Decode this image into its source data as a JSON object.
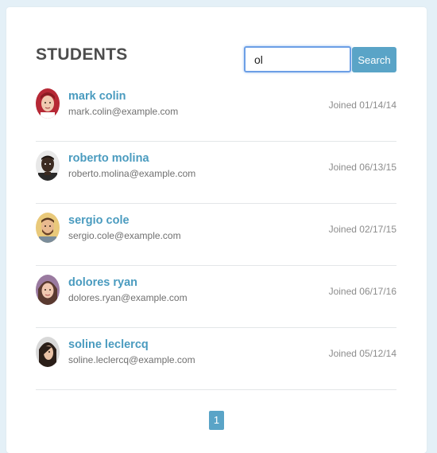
{
  "page": {
    "title": "STUDENTS"
  },
  "search": {
    "value": "ol",
    "button_label": "Search"
  },
  "students": [
    {
      "name": "mark colin",
      "email": "mark.colin@example.com",
      "joined": "Joined 01/14/14",
      "avatar": "avatar-photo-woman-red-hair"
    },
    {
      "name": "roberto molina",
      "email": "roberto.molina@example.com",
      "joined": "Joined 06/13/15",
      "avatar": "avatar-photo-man-dark-skin"
    },
    {
      "name": "sergio cole",
      "email": "sergio.cole@example.com",
      "joined": "Joined 02/17/15",
      "avatar": "avatar-photo-man-beard"
    },
    {
      "name": "dolores ryan",
      "email": "dolores.ryan@example.com",
      "joined": "Joined 06/17/16",
      "avatar": "avatar-photo-woman-curly-hair"
    },
    {
      "name": "soline leclercq",
      "email": "soline.leclercq@example.com",
      "joined": "Joined 05/12/14",
      "avatar": "avatar-photo-woman-long-hair"
    }
  ],
  "pagination": {
    "pages": [
      "1"
    ],
    "current": "1"
  },
  "colors": {
    "accent": "#5aa4c7",
    "name_link": "#4a9bbf",
    "background": "#e4f0f7",
    "focus_border": "#6c9fe6"
  }
}
